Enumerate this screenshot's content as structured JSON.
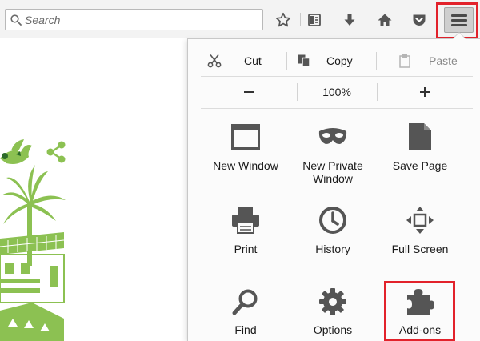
{
  "toolbar": {
    "search_placeholder": "Search",
    "icons": [
      "search-icon",
      "bookmark-star-icon",
      "reading-list-icon",
      "download-icon",
      "home-icon",
      "pocket-icon",
      "hamburger-menu-icon"
    ]
  },
  "menu": {
    "edit": {
      "cut": "Cut",
      "copy": "Copy",
      "paste": "Paste"
    },
    "zoom": {
      "minus": "−",
      "level": "100%",
      "plus": "+"
    },
    "items": [
      {
        "label": "New Window",
        "icon": "new-window-icon"
      },
      {
        "label": "New Private\nWindow",
        "icon": "private-mask-icon"
      },
      {
        "label": "Save Page",
        "icon": "save-page-icon"
      },
      {
        "label": "Print",
        "icon": "printer-icon"
      },
      {
        "label": "History",
        "icon": "clock-icon"
      },
      {
        "label": "Full Screen",
        "icon": "fullscreen-icon"
      },
      {
        "label": "Find",
        "icon": "magnifier-icon"
      },
      {
        "label": "Options",
        "icon": "gear-icon"
      },
      {
        "label": "Add-ons",
        "icon": "puzzle-icon"
      }
    ]
  },
  "colors": {
    "highlight": "#e2222b",
    "icon": "#555555",
    "art_green": "#8cc152"
  }
}
